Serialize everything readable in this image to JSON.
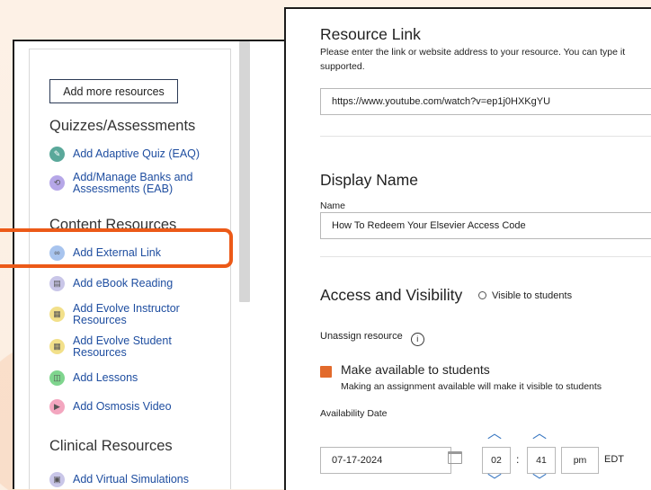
{
  "left": {
    "add_more_button": "Add more resources",
    "quizzes_title": "Quizzes/Assessments",
    "quiz_items": [
      "Add Adaptive Quiz (EAQ)",
      "Add/Manage Banks and Assessments (EAB)"
    ],
    "content_title": "Content Resources",
    "content_items": [
      "Add External Link",
      "Add eBook Reading",
      "Add Evolve Instructor Resources",
      "Add Evolve Student Resources",
      "Add Lessons",
      "Add Osmosis Video"
    ],
    "clinical_title": "Clinical Resources",
    "clinical_items": [
      "Add Virtual Simulations"
    ]
  },
  "right": {
    "resource_link_title": "Resource Link",
    "resource_link_help": "Please enter the link or website address to your resource. You can type it",
    "resource_link_help2": "supported.",
    "resource_link_value": "https://www.youtube.com/watch?v=ep1j0HXKgYU",
    "display_name_title": "Display Name",
    "name_label": "Name",
    "name_value": "How To Redeem Your Elsevier Access Code",
    "access_title": "Access and Visibility",
    "visible_badge": "Visible to students",
    "unassign_label": "Unassign resource",
    "make_available_label": "Make available to students",
    "make_available_help": "Making an assignment available will make it visible to students",
    "availability_date_label": "Availability Date",
    "date_value": "07-17-2024",
    "hour_value": "02",
    "minute_value": "41",
    "ampm_value": "pm",
    "timezone": "EDT"
  },
  "colors": {
    "highlight": "#ec5a18",
    "link_blue": "#1f4ea0",
    "checkbox_orange": "#e26a2c"
  }
}
